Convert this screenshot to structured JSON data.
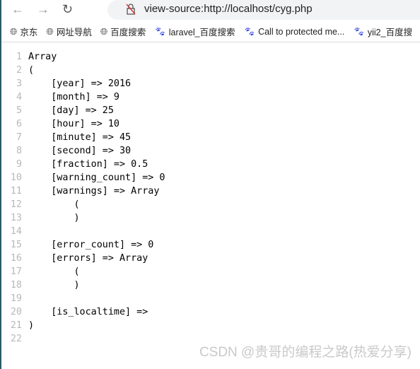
{
  "browser": {
    "url": "view-source:http://localhost/cyg.php",
    "bookmarks": [
      {
        "icon": "globe-icon",
        "label": "京东"
      },
      {
        "icon": "globe-icon",
        "label": "网址导航"
      },
      {
        "icon": "globe-icon",
        "label": "百度搜索"
      },
      {
        "icon": "baidu-paw-icon",
        "label": "laravel_百度搜索"
      },
      {
        "icon": "baidu-paw-icon",
        "label": "Call to protected me..."
      },
      {
        "icon": "baidu-paw-icon",
        "label": "yii2_百度搜"
      }
    ]
  },
  "source_lines": [
    "Array",
    "(",
    "    [year] => 2016",
    "    [month] => 9",
    "    [day] => 25",
    "    [hour] => 10",
    "    [minute] => 45",
    "    [second] => 30",
    "    [fraction] => 0.5",
    "    [warning_count] => 0",
    "    [warnings] => Array",
    "        (",
    "        )",
    "",
    "    [error_count] => 0",
    "    [errors] => Array",
    "        (",
    "        )",
    "",
    "    [is_localtime] => ",
    ")",
    ""
  ],
  "watermark": "CSDN @贵哥的编程之路(热爱分享)"
}
